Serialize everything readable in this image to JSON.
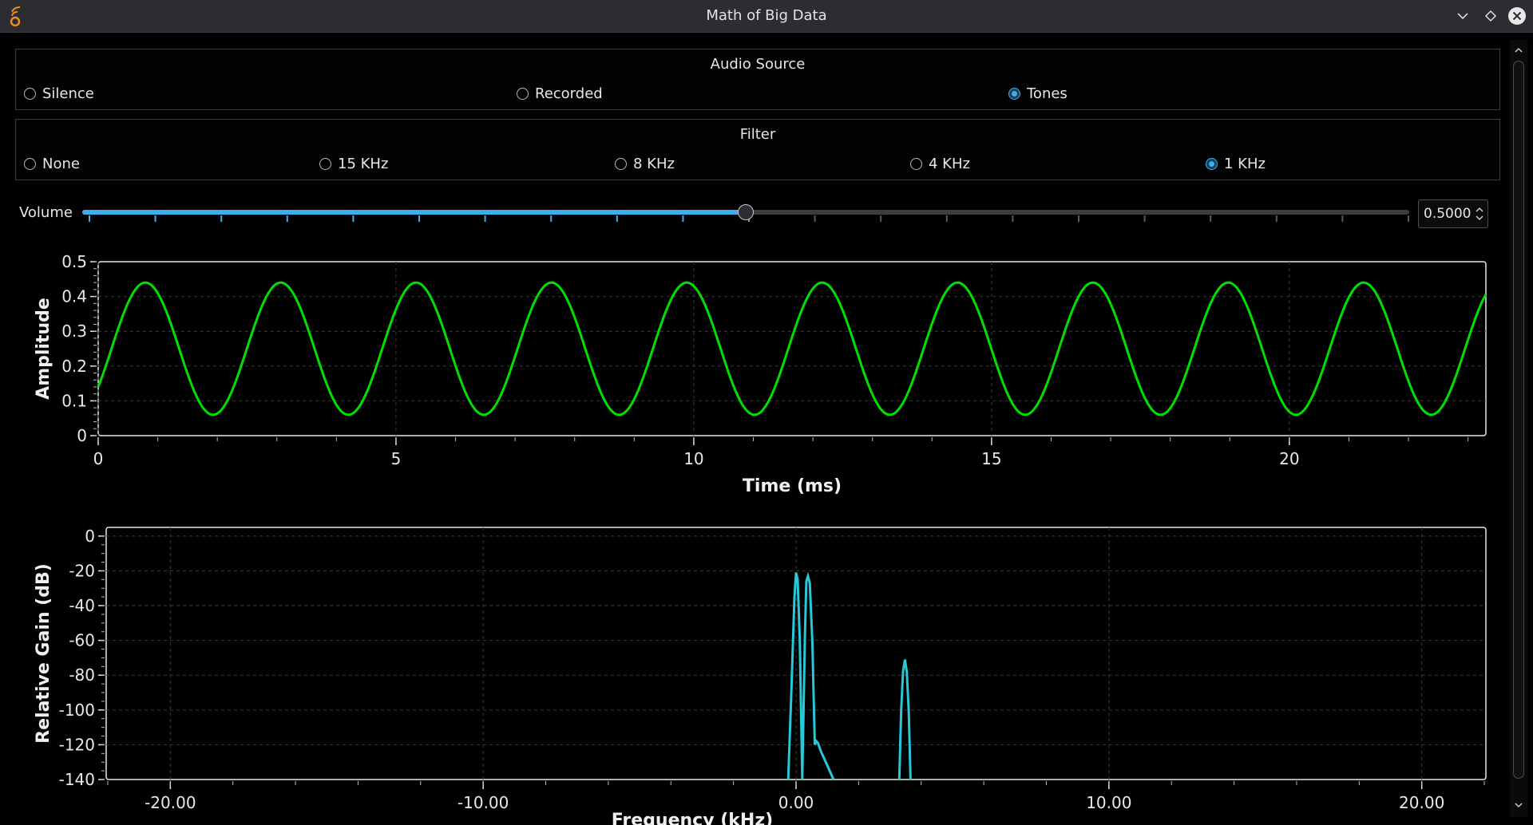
{
  "window": {
    "title": "Math of Big Data"
  },
  "audio_source": {
    "title": "Audio Source",
    "options": [
      {
        "label": "Silence",
        "checked": false
      },
      {
        "label": "Recorded",
        "checked": false
      },
      {
        "label": "Tones",
        "checked": true
      }
    ]
  },
  "filter": {
    "title": "Filter",
    "options": [
      {
        "label": "None",
        "checked": false
      },
      {
        "label": "15 KHz",
        "checked": false
      },
      {
        "label": "8 KHz",
        "checked": false
      },
      {
        "label": "4 KHz",
        "checked": false
      },
      {
        "label": "1 KHz",
        "checked": true
      }
    ]
  },
  "volume": {
    "label": "Volume",
    "value": "0.5000",
    "fraction": 0.5,
    "tick_count": 21
  },
  "colors": {
    "accent": "#3daee9",
    "time_trace": "#00e000",
    "freq_trace": "#28c8d8"
  },
  "chart_data": [
    {
      "type": "line",
      "xlabel": "Time (ms)",
      "ylabel": "Amplitude",
      "xlim": [
        0,
        23.3
      ],
      "ylim": [
        0,
        0.5
      ],
      "x_ticks": [
        "0",
        "5",
        "10",
        "15",
        "20"
      ],
      "y_ticks": [
        "0",
        "0.1",
        "0.2",
        "0.3",
        "0.4",
        "0.5"
      ],
      "grid": true,
      "series": [
        {
          "kind": "sine",
          "offset": 0.25,
          "amplitude": 0.19,
          "frequency_khz": 0.44,
          "phase_start_value": 0.14
        }
      ]
    },
    {
      "type": "line",
      "xlabel": "Frequency (kHz)",
      "ylabel": "Relative Gain (dB)",
      "xlim": [
        -22.05,
        22.05
      ],
      "ylim": [
        -140,
        5
      ],
      "x_ticks": [
        "-20.00",
        "-10.00",
        "0.00",
        "10.00",
        "20.00"
      ],
      "y_ticks": [
        "0",
        "-20",
        "-40",
        "-60",
        "-80",
        "-100",
        "-120",
        "-140"
      ],
      "grid": true,
      "series": [
        {
          "x": [
            -0.25,
            -0.15,
            -0.05,
            0.0,
            0.05,
            0.12,
            0.2,
            0.28,
            0.33,
            0.38,
            0.44,
            0.52,
            0.6,
            0.65,
            0.7,
            0.8,
            0.9,
            1.0,
            1.1,
            1.2
          ],
          "y": [
            -140,
            -90,
            -35,
            -21,
            -25,
            -60,
            -140,
            -60,
            -26,
            -23,
            -27,
            -60,
            -120,
            -118,
            -119,
            -124,
            -128,
            -132,
            -136,
            -140
          ]
        },
        {
          "x": [
            3.3,
            3.36,
            3.42,
            3.48,
            3.54,
            3.6,
            3.66
          ],
          "y": [
            -140,
            -100,
            -78,
            -71,
            -78,
            -100,
            -140
          ]
        }
      ]
    }
  ]
}
